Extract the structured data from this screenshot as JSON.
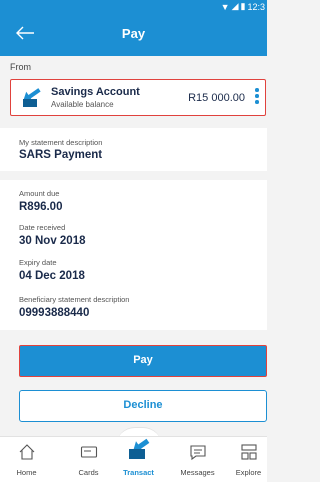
{
  "status_bar": {
    "time": "12:3"
  },
  "header": {
    "back_icon": "arrow-left-icon",
    "title": "Pay"
  },
  "from": {
    "label": "From",
    "account_name": "Savings Account",
    "account_sub": "Available balance",
    "balance": "R15 000.00"
  },
  "statement": {
    "label": "My statement description",
    "value": "SARS Payment"
  },
  "details": [
    {
      "label": "Amount due",
      "value": "R896.00"
    },
    {
      "label": "Date received",
      "value": "30 Nov 2018"
    },
    {
      "label": "Expiry date",
      "value": "04 Dec 2018"
    },
    {
      "label": "Beneficiary statement description",
      "value": "09993888440"
    }
  ],
  "buttons": {
    "pay": "Pay",
    "decline": "Decline"
  },
  "nav": [
    {
      "label": "Home",
      "icon": "home-icon"
    },
    {
      "label": "Cards",
      "icon": "card-icon"
    },
    {
      "label": "Transact",
      "icon": "transact-icon"
    },
    {
      "label": "Messages",
      "icon": "message-icon"
    },
    {
      "label": "Explore",
      "icon": "explore-icon"
    }
  ],
  "colors": {
    "primary": "#1c8fd3",
    "highlight": "#e0423d",
    "text_dark": "#1a2a4a"
  }
}
